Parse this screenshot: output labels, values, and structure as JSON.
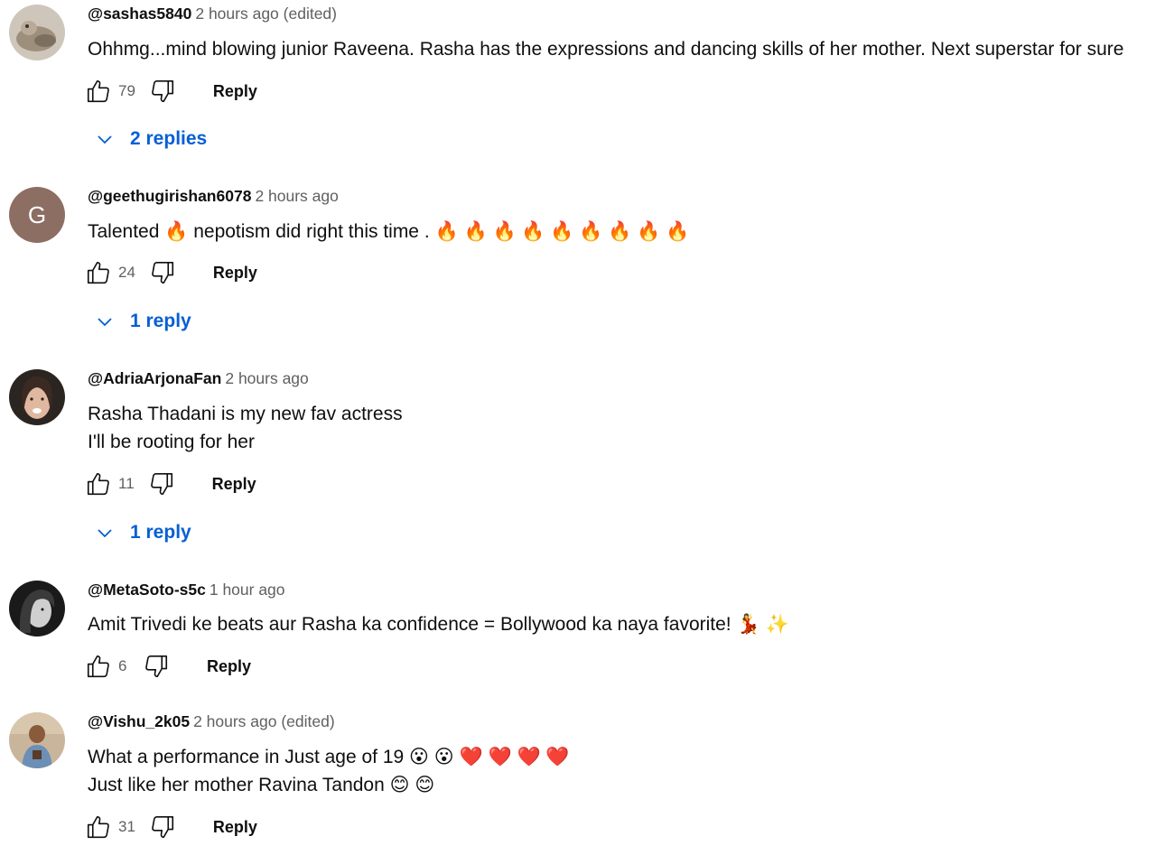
{
  "comments": [
    {
      "author": "@sashas5840",
      "time": "2 hours ago (edited)",
      "lines": [
        "Ohhmg...mind blowing junior Raveena. Rasha has the expressions and dancing skills of her mother. Next superstar for sure"
      ],
      "likes": "79",
      "reply_label": "Reply",
      "replies_label": "2 replies"
    },
    {
      "author": "@geethugirishan6078",
      "time": "2 hours ago",
      "lines": [
        "Talented 🔥 nepotism did right this time . 🔥 🔥 🔥 🔥 🔥 🔥 🔥 🔥 🔥"
      ],
      "likes": "24",
      "reply_label": "Reply",
      "replies_label": "1 reply",
      "avatar_letter": "G"
    },
    {
      "author": "@AdriaArjonaFan",
      "time": "2 hours ago",
      "lines": [
        "Rasha Thadani is my new fav actress",
        "I'll be rooting for her"
      ],
      "likes": "11",
      "reply_label": "Reply",
      "replies_label": "1 reply"
    },
    {
      "author": "@MetaSoto-s5c",
      "time": "1 hour ago",
      "lines": [
        "Amit Trivedi ke beats aur Rasha ka confidence = Bollywood ka naya favorite! 💃 ✨"
      ],
      "likes": "6",
      "reply_label": "Reply"
    },
    {
      "author": "@Vishu_2k05",
      "time": "2 hours ago (edited)",
      "lines": [
        "What a performance in Just age of 19 😮 😮 ❤️ ❤️ ❤️ ❤️",
        "Just like her mother Ravina Tandon 😊 😊"
      ],
      "likes": "31",
      "reply_label": "Reply"
    }
  ],
  "colors": {
    "link_blue": "#065fd4",
    "meta_gray": "#606060",
    "text": "#0f0f0f",
    "avatar_g_bg": "#8d6e63"
  },
  "icons": [
    "thumbs-up-icon",
    "thumbs-down-icon",
    "chevron-down-icon"
  ]
}
